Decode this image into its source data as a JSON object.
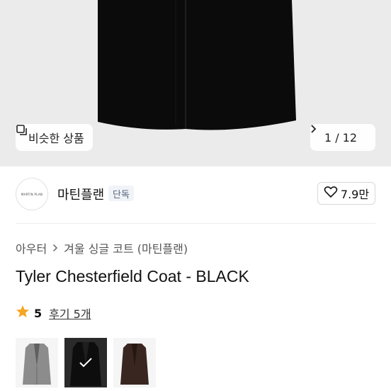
{
  "hero": {
    "similar_label": "비슷한 상품",
    "counter": "1 / 12"
  },
  "brand": {
    "logo_text": "MARTIN PLAN",
    "name": "마틴플랜",
    "badge": "단독",
    "likes": "7.9만"
  },
  "breadcrumb": [
    "아우터",
    "겨울 싱글 코트 (마틴플랜)"
  ],
  "product": {
    "title": "Tyler Chesterfield Coat - BLACK",
    "rating": "5",
    "reviews": "후기 5개"
  },
  "swatches": [
    {
      "name": "grey",
      "color": "#8a8a8a"
    },
    {
      "name": "black",
      "color": "#121212",
      "selected": true
    },
    {
      "name": "brown",
      "color": "#3a2620"
    }
  ],
  "colors": {
    "accent_star": "#f5a623",
    "hero_bg": "#ebebeb"
  }
}
